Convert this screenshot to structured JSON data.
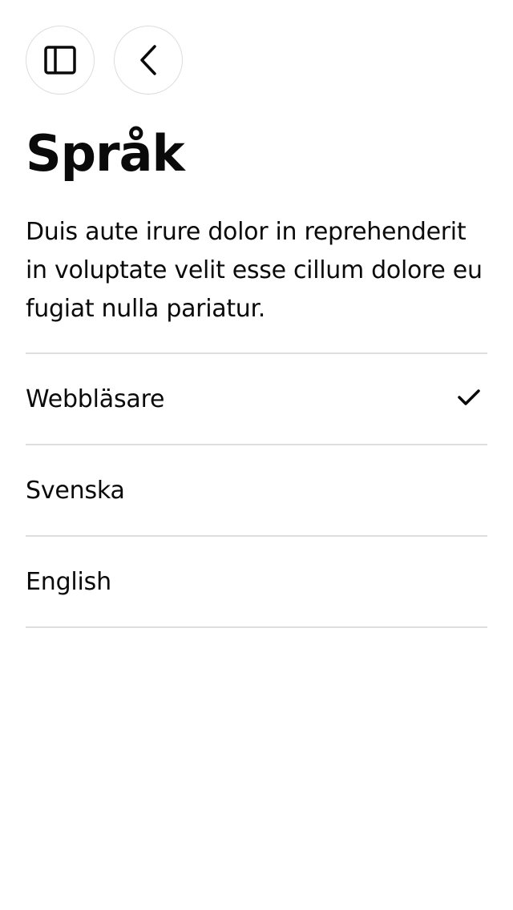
{
  "header": {
    "title": "Språk",
    "description": "Duis aute irure dolor in reprehenderit in voluptate velit esse cillum dolore eu fugiat nulla pariatur."
  },
  "toolbar": {
    "sidebar_icon": "sidebar-icon",
    "back_icon": "chevron-left-icon"
  },
  "languages": {
    "items": [
      {
        "label": "Webbläsare",
        "selected": true
      },
      {
        "label": "Svenska",
        "selected": false
      },
      {
        "label": "English",
        "selected": false
      }
    ]
  },
  "colors": {
    "text": "#0a0a0a",
    "divider": "#dedede",
    "button_border": "#dcdcdc"
  }
}
